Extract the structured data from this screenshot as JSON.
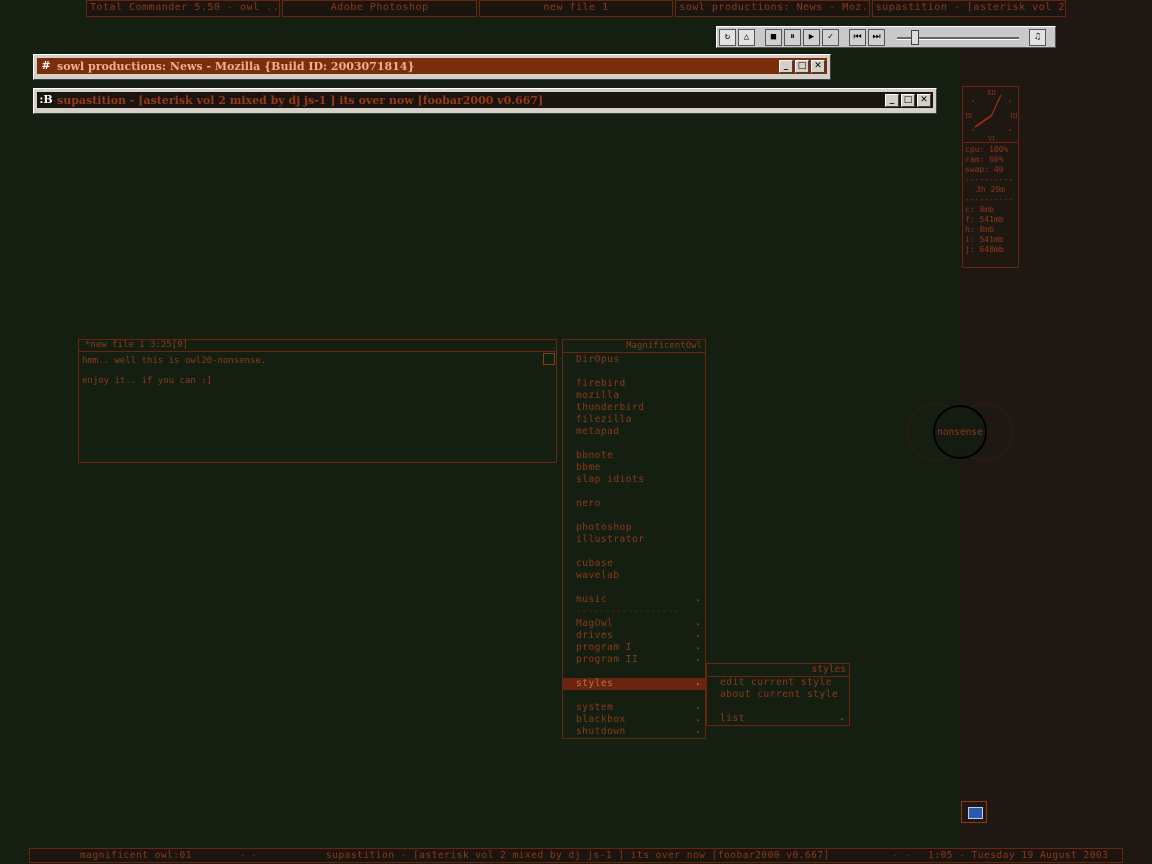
{
  "taskbar": {
    "tasks": [
      "Total Commander 5.50 - owl ...",
      "Adobe Photoshop",
      "new file 1",
      "sowl productions: News - Moz...",
      "supastition - [asterisk vol 2 ..."
    ]
  },
  "media": {
    "buttons": [
      "↻",
      "△",
      "■",
      "⏸",
      "▶",
      "✓",
      "⏮",
      "⏭",
      "♫"
    ]
  },
  "mozilla_window": {
    "title": "sowl productions: News - Mozilla {Build ID: 2003071814}",
    "icon": "#"
  },
  "foobar_window": {
    "title": "supastition - [asterisk vol 2 mixed by dj js-1 ] its over now    [foobar2000 v0.667]",
    "icon": ":B"
  },
  "window_controls": {
    "minimize": "_",
    "maximize": "□",
    "close": "✕"
  },
  "clock": {
    "numerals": [
      "XII",
      "III",
      "VI",
      "IX"
    ]
  },
  "stats": [
    "cpu: 100%",
    "ram: 66%",
    "swap: 40",
    "----------",
    "3h 29m",
    "----------",
    "c: 8mb",
    "f: 541mb",
    "h: 8mb",
    "i: 541mb",
    "j: 648mb"
  ],
  "note": {
    "title": "*new file 1  3:25[9]",
    "line1": "hmm.. well this is owl20-nonsense.",
    "line2": "enjoy it.. if you can :]"
  },
  "menu": {
    "title": "MagnificentOwl",
    "items": [
      {
        "label": "DirOpus",
        "arrow": false
      },
      {
        "label": ".",
        "arrow": false
      },
      {
        "label": "firebird",
        "arrow": false
      },
      {
        "label": "mozilla",
        "arrow": false
      },
      {
        "label": "thunderbird",
        "arrow": false
      },
      {
        "label": "filezilla",
        "arrow": false
      },
      {
        "label": "metapad",
        "arrow": false
      },
      {
        "label": ".",
        "arrow": false
      },
      {
        "label": "bbnote",
        "arrow": false
      },
      {
        "label": "bbme",
        "arrow": false
      },
      {
        "label": "slap idiots",
        "arrow": false
      },
      {
        "label": ".",
        "arrow": false
      },
      {
        "label": "nero",
        "arrow": false
      },
      {
        "label": ".",
        "arrow": false
      },
      {
        "label": "photoshop",
        "arrow": false
      },
      {
        "label": "illustrator",
        "arrow": false
      },
      {
        "label": ".",
        "arrow": false
      },
      {
        "label": "cubase",
        "arrow": false
      },
      {
        "label": "wavelab",
        "arrow": false
      },
      {
        "label": ".",
        "arrow": false
      },
      {
        "label": "music",
        "arrow": true
      },
      {
        "label": "------------------",
        "arrow": false
      },
      {
        "label": "MagOwl",
        "arrow": true
      },
      {
        "label": "drives",
        "arrow": true
      },
      {
        "label": "program I",
        "arrow": true
      },
      {
        "label": "program II",
        "arrow": true
      },
      {
        "label": ".",
        "arrow": false
      },
      {
        "label": "styles",
        "arrow": true,
        "selected": true
      },
      {
        "label": ".",
        "arrow": false
      },
      {
        "label": "system",
        "arrow": true
      },
      {
        "label": "blackbox",
        "arrow": true
      },
      {
        "label": "shutdown",
        "arrow": true
      }
    ]
  },
  "submenu": {
    "title": "styles",
    "items": [
      {
        "label": "edit current style",
        "arrow": false
      },
      {
        "label": "about current style",
        "arrow": false
      },
      {
        "label": ".",
        "arrow": false
      },
      {
        "label": "list",
        "arrow": true
      }
    ]
  },
  "circles": {
    "label": "nonsense"
  },
  "bottombar": {
    "workspace": "magnificent owl:01",
    "track": "supastition - [asterisk vol 2 mixed by dj js-1 ] its over now    [foobar2000 v0.667]",
    "clock": "1:05 - Tuesday 19 August 2003",
    "left_arrow": "◂",
    "right_arrow": "▸"
  },
  "colors": {
    "background": "#141f12",
    "accent": "#7a2e0c",
    "text": "#8b3a1c"
  }
}
